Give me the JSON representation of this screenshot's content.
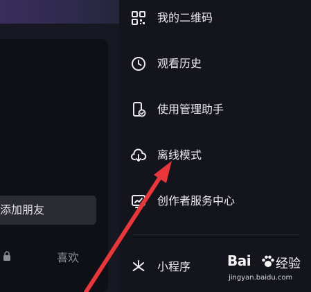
{
  "profile": {
    "add_friend_label": "添加朋友",
    "likes_tab_label": "喜欢"
  },
  "menu": {
    "items": [
      {
        "label": "我的二维码",
        "icon": "qr-code-icon"
      },
      {
        "label": "观看历史",
        "icon": "clock-icon"
      },
      {
        "label": "使用管理助手",
        "icon": "phone-check-icon"
      },
      {
        "label": "离线模式",
        "icon": "cloud-download-icon"
      },
      {
        "label": "创作者服务中心",
        "icon": "creator-chart-icon"
      },
      {
        "label": "小程序",
        "icon": "mini-program-icon"
      }
    ]
  },
  "annotation": {
    "arrow_color": "#e8373a",
    "target": "离线模式"
  },
  "watermark": {
    "brand": "Bai",
    "brand_suffix": "经验",
    "url": "jingyan.baidu.com"
  },
  "colors": {
    "background": "#14141d",
    "menu_text": "#eaeaee",
    "arrow": "#e8373a"
  }
}
